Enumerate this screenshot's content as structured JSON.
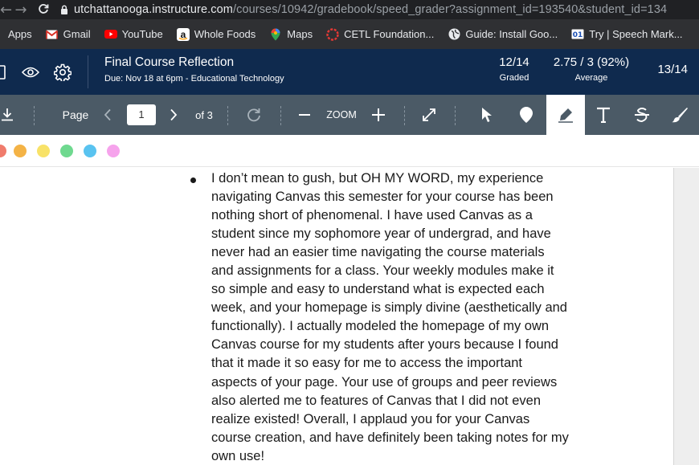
{
  "browser": {
    "url_host": "utchattanooga.instructure.com",
    "url_path": "/courses/10942/gradebook/speed_grader?assignment_id=193540&student_id=134"
  },
  "bookmarks": [
    {
      "label": "Apps",
      "icon": "apps-grid-icon"
    },
    {
      "label": "Gmail",
      "icon": "gmail-icon"
    },
    {
      "label": "YouTube",
      "icon": "youtube-icon"
    },
    {
      "label": "Whole Foods",
      "icon": "amazon-icon"
    },
    {
      "label": "Maps",
      "icon": "maps-pin-icon"
    },
    {
      "label": "CETL Foundation...",
      "icon": "red-ring-icon"
    },
    {
      "label": "Guide: Install Goo...",
      "icon": "globe-icon"
    },
    {
      "label": "Try | Speech Mark...",
      "icon": "speech-icon"
    }
  ],
  "header": {
    "title": "Final Course Reflection",
    "due": "Due: Nov 18 at 6pm - Educational Technology",
    "graded_value": "12/14",
    "graded_label": "Graded",
    "average_value": "2.75 / 3 (92%)",
    "average_label": "Average",
    "student_position": "13/14"
  },
  "toolbar": {
    "page_label": "Page",
    "page_value": "1",
    "of_label": "of 3",
    "zoom_label": "ZOOM"
  },
  "annotation_colors": [
    "#f07c6c",
    "#f4b346",
    "#f8e268",
    "#6fd98f",
    "#59c3f0",
    "#f6a3ec"
  ],
  "document": {
    "paragraph_lines": [
      "I don’t mean to gush, but OH MY WORD, my experience",
      "navigating Canvas this semester for your course has been",
      "nothing short of phenomenal. I have used Canvas as a",
      "student since my sophomore year of undergrad, and have",
      "never had an easier time navigating the course materials",
      "and assignments for a class. Your weekly modules make it",
      "so simple and easy to understand what is expected each",
      "week, and your homepage is simply divine (aesthetically and",
      "functionally). I actually modeled the homepage of my own",
      "Canvas course for my students after yours because I found",
      "that it made it so easy for me to access the important",
      "aspects of your page. Your use of groups and peer reviews",
      "also alerted me to features of Canvas that I did not even",
      "realize existed! Overall, I applaud you for your Canvas",
      "course creation, and have definitely been taking notes for my",
      "own use!"
    ]
  }
}
